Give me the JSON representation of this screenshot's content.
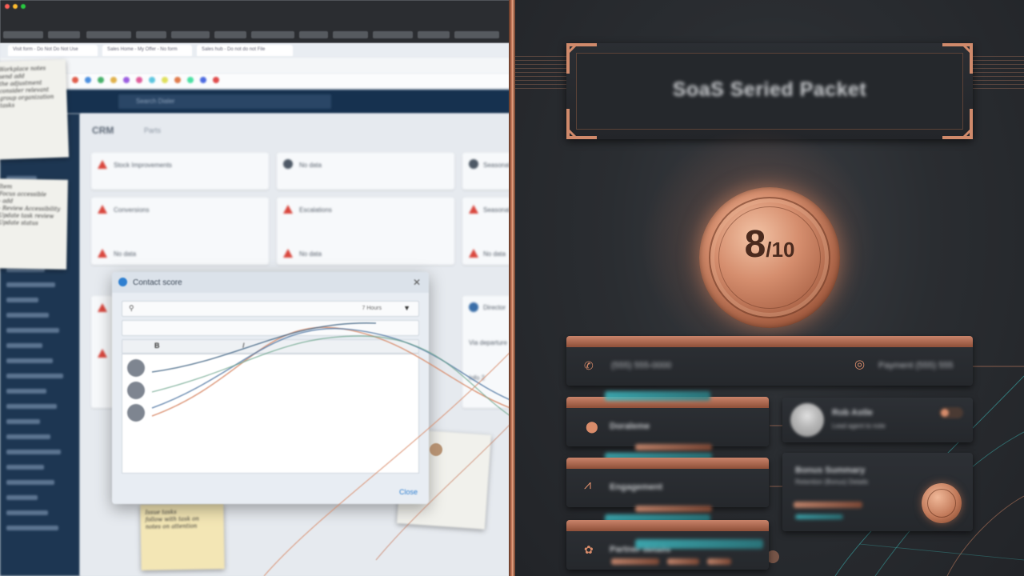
{
  "browser": {
    "tabs": [
      "Visit form - Do Not Do Not Use",
      "Sales Home - My Offer - No form",
      "Sales hub - Do not do not File"
    ],
    "search_placeholder": "Search Dialer"
  },
  "crm": {
    "title": "CRM",
    "breadcrumb": "Parts",
    "widgets": [
      {
        "label": "Stock Improvements",
        "icon": "warning-icon"
      },
      {
        "label": "No data",
        "icon": "user-icon"
      },
      {
        "label": "Seasonal",
        "icon": "user-icon"
      },
      {
        "label": "Conversions",
        "icon": "warning-icon"
      },
      {
        "label": "Escalations",
        "icon": "warning-icon"
      },
      {
        "label": "Seasonal",
        "icon": "warning-icon"
      },
      {
        "label": "No data",
        "icon": "warning-icon"
      },
      {
        "label": "No data",
        "icon": "warning-icon"
      },
      {
        "label": "No data",
        "icon": "warning-icon"
      }
    ],
    "right_widget_lines": [
      "Director",
      "Via departure",
      "Info 2"
    ],
    "sidebar_items": 24
  },
  "notes": {
    "note1": "Workplace notes\nsend add\nthe adjustment\nconsider relevant\ngroup organization\ntasks",
    "note2": "Item\nFocus accessible\n- add\n- Review Accessibility\nUpdate task review\nUpdate status",
    "note3": "Issue tasks\nfollow with task on\nnotes on attention"
  },
  "dialog": {
    "title": "Contact score",
    "row1_value": "7 Hours",
    "close_label": "Close"
  },
  "packet": {
    "title": "SoaS Seried Packet",
    "score_value": "8",
    "score_denominator": "/10",
    "phone": "(555) 555-0000",
    "phone_right": "Payment (555) 555",
    "location": "Doraleme",
    "activity": "Engagement",
    "extra": "Partner details",
    "profile_name": "Rob Astle",
    "profile_sub": "Lead agent to note",
    "bonus_title": "Bonus Summary",
    "bonus_sub": "Retention (Bonus) Details"
  },
  "colors": {
    "copper": "#c9836a",
    "teal": "#3fb8c0",
    "panel_bg": "#2a2d31",
    "crm_nav": "#16314f"
  }
}
